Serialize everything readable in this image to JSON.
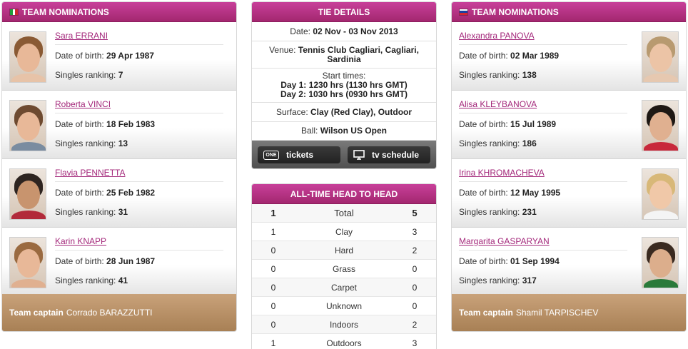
{
  "left_team": {
    "header": "TEAM NOMINATIONS",
    "flag_colors": [
      "#1f9d3a",
      "#ffffff",
      "#d22630"
    ],
    "dob_label": "Date of birth:",
    "rank_label": "Singles ranking:",
    "players": [
      {
        "name": "Sara ERRANI",
        "dob": "29 Apr 1987",
        "ranking": "7"
      },
      {
        "name": "Roberta VINCI",
        "dob": "18 Feb 1983",
        "ranking": "13"
      },
      {
        "name": "Flavia PENNETTA",
        "dob": "25 Feb 1982",
        "ranking": "31"
      },
      {
        "name": "Karin KNAPP",
        "dob": "28 Jun 1987",
        "ranking": "41"
      }
    ],
    "captain_label": "Team captain",
    "captain_name": "Corrado BARAZZUTTI"
  },
  "right_team": {
    "header": "TEAM NOMINATIONS",
    "flag_colors": [
      "#ffffff",
      "#1a3fa0",
      "#d22630"
    ],
    "dob_label": "Date of birth:",
    "rank_label": "Singles ranking:",
    "players": [
      {
        "name": "Alexandra PANOVA",
        "dob": "02 Mar 1989",
        "ranking": "138"
      },
      {
        "name": "Alisa KLEYBANOVA",
        "dob": "15 Jul 1989",
        "ranking": "186"
      },
      {
        "name": "Irina KHROMACHEVA",
        "dob": "12 May 1995",
        "ranking": "231"
      },
      {
        "name": "Margarita GASPARYAN",
        "dob": "01 Sep 1994",
        "ranking": "317"
      }
    ],
    "captain_label": "Team captain",
    "captain_name": "Shamil TARPISCHEV"
  },
  "tie_details": {
    "header": "TIE DETAILS",
    "date_label": "Date:",
    "date": "02 Nov - 03 Nov 2013",
    "venue_label": "Venue:",
    "venue": "Tennis Club Cagliari, Cagliari, Sardinia",
    "start_label": "Start times:",
    "day1_label": "Day 1:",
    "day1": "1230 hrs (1130 hrs GMT)",
    "day2_label": "Day 2:",
    "day2": "1030 hrs (0930 hrs GMT)",
    "surface_label": "Surface:",
    "surface": "Clay (Red Clay), Outdoor",
    "ball_label": "Ball:",
    "ball": "Wilson US Open",
    "tickets_icon_text": "ONE",
    "tickets_label": "tickets",
    "tv_label": "tv schedule"
  },
  "head_to_head": {
    "header": "ALL-TIME HEAD TO HEAD",
    "rows": [
      {
        "left": "1",
        "label": "Total",
        "right": "5"
      },
      {
        "left": "1",
        "label": "Clay",
        "right": "3"
      },
      {
        "left": "0",
        "label": "Hard",
        "right": "2"
      },
      {
        "left": "0",
        "label": "Grass",
        "right": "0"
      },
      {
        "left": "0",
        "label": "Carpet",
        "right": "0"
      },
      {
        "left": "0",
        "label": "Unknown",
        "right": "0"
      },
      {
        "left": "0",
        "label": "Indoors",
        "right": "2"
      },
      {
        "left": "1",
        "label": "Outdoors",
        "right": "3"
      }
    ]
  }
}
